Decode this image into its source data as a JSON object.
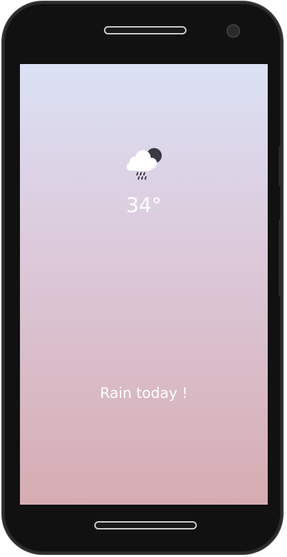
{
  "weather": {
    "icon": "cloud-rain-moon-icon",
    "temperature": "34°",
    "message": "Rain today !"
  },
  "colors": {
    "screen_top": "#dbe1f5",
    "screen_bottom": "#d6acb2",
    "text": "#ffffff",
    "icon_dark": "#3a3a44"
  }
}
